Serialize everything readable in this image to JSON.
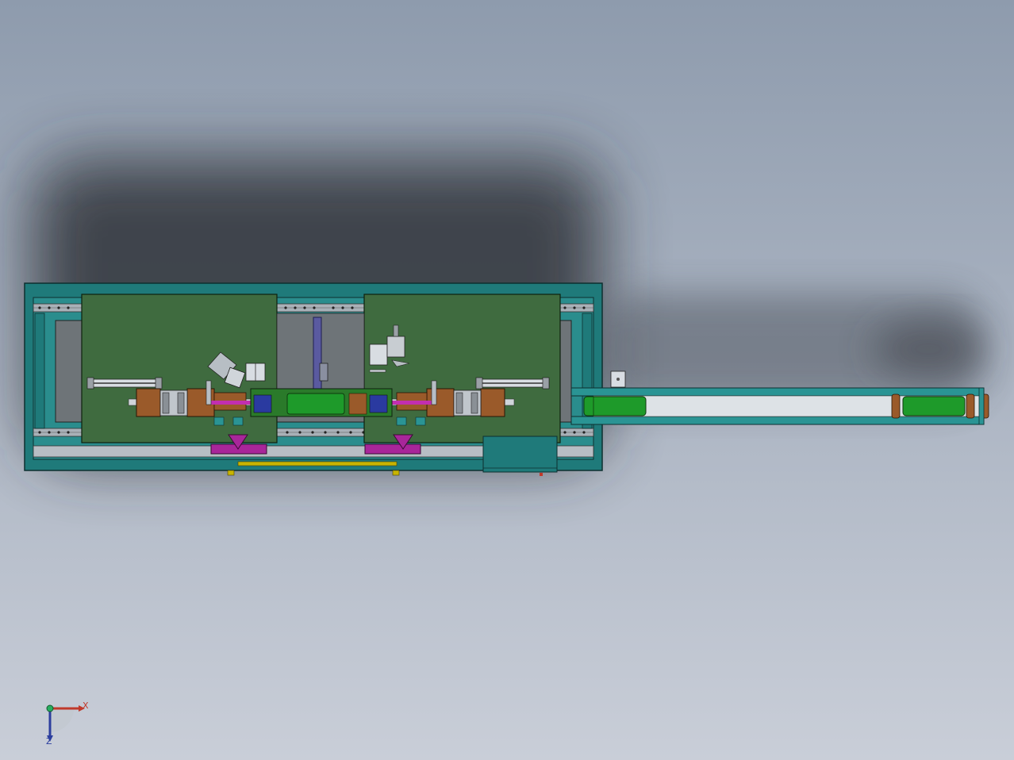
{
  "view": {
    "background_top": "#8e9bad",
    "background_bottom": "#c9ced8",
    "shadow_color": "#3a3d44"
  },
  "colors": {
    "frame_teal": "#1f7a7a",
    "frame_teal_light": "#2a9494",
    "plate_green": "#3f6b3f",
    "part_green": "#1e9a2a",
    "bracket_brown": "#9a5a2a",
    "fixture_magenta": "#a8269a",
    "rail_gray": "#a9b1b8",
    "column_purple": "#5a5aa0",
    "accent_yellow": "#c8b400",
    "slot_gray": "#6e7478"
  },
  "triad": {
    "x_label": "X",
    "z_label": "Z",
    "x_color": "#c0392b",
    "y_color": "#27ae60",
    "z_color": "#2c3e9e"
  }
}
